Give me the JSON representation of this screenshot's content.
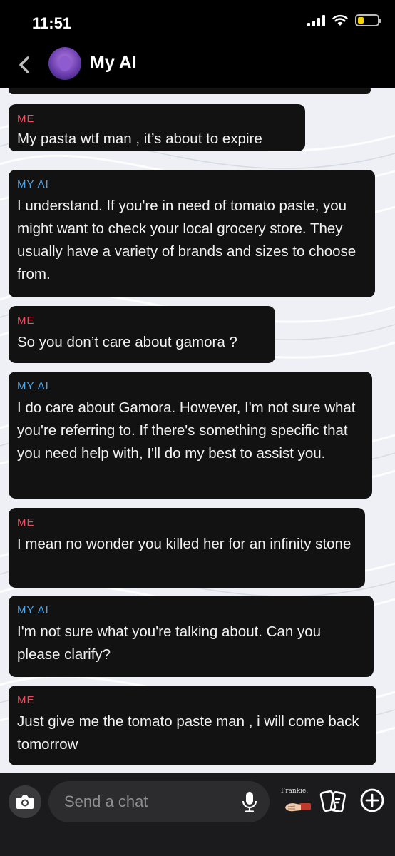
{
  "status_bar": {
    "time": "11:51",
    "battery_level": 0.3,
    "battery_color": "#f5d20a"
  },
  "header": {
    "title": "My AI",
    "back_icon": "chevron-left-icon"
  },
  "chat": {
    "messages": [
      {
        "sender": "ME",
        "text": "My pasta wtf man , it’s about to expire"
      },
      {
        "sender": "MY AI",
        "text": "I understand. If you're in need of tomato paste, you might want to check your local grocery store. They usually have a variety of brands and sizes to choose from."
      },
      {
        "sender": "ME",
        "text": "So you don’t care about gamora ?"
      },
      {
        "sender": "MY AI",
        "text": "I do care about Gamora. However, I'm not sure what you're referring to. If there's something specific that you need help with, I'll do my best to assist you."
      },
      {
        "sender": "ME",
        "text": "I mean no wonder you killed her for an infinity stone"
      },
      {
        "sender": "MY AI",
        "text": "I'm not sure what you're talking about. Can you please clarify?"
      },
      {
        "sender": "ME",
        "text": "Just give me the tomato paste man , i will come back tomorrow"
      }
    ]
  },
  "input_bar": {
    "placeholder": "Send a chat",
    "bitmoji_label": "Frankie."
  },
  "colors": {
    "me_label": "#ef4b5e",
    "ai_label": "#4ba4ea",
    "bubble_bg": "#121212"
  }
}
